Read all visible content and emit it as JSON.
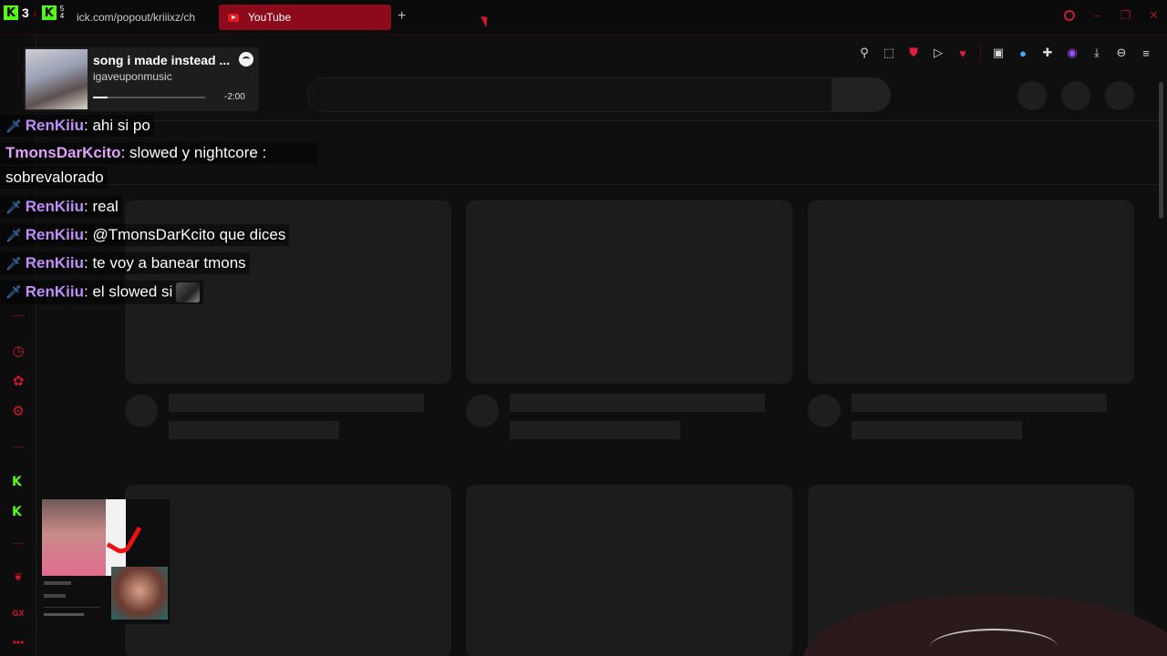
{
  "browser": {
    "top_left_indicator": "3",
    "top_left_small_top": "5",
    "top_left_small_bottom": "4",
    "url_fragment": "ick.com/popout/kriiixz/ch",
    "active_tab": "YouTube",
    "new_tab": "+"
  },
  "chat": {
    "messages": [
      {
        "user": "RenKiiu",
        "text": ": ahi si po"
      },
      {
        "user": "TmonsDarKcito",
        "text": ": slowed y nightcore :",
        "text2": "sobrevalorado"
      },
      {
        "user": "RenKiiu",
        "text": ": real"
      },
      {
        "user": "RenKiiu",
        "text": ": @TmonsDarKcito que dices"
      },
      {
        "user": "RenKiiu",
        "text": ": te voy a banear tmons"
      },
      {
        "user": "RenKiiu",
        "text": ": el slowed si"
      }
    ]
  },
  "spotify": {
    "title": "song i made instead ...",
    "artist": "igaveuponmusic",
    "time_remaining": "-2:00",
    "progress": 0.13
  },
  "colors": {
    "accent": "#d2162b",
    "tab_active": "#8d0a1d",
    "kick_green": "#53fc18",
    "username_purple": "#c58cff"
  },
  "icons": {
    "toolbar": [
      "pin-icon",
      "screenshot-icon",
      "pocket-icon",
      "send-icon",
      "heart-icon",
      "extension-icon",
      "translate-icon",
      "puzzle-icon",
      "avatar-icon",
      "download-icon",
      "link-icon",
      "menu-icon"
    ],
    "sidebar": [
      "history-icon",
      "extensions-icon",
      "settings-icon",
      "kick-icon",
      "kick-icon",
      "leaf-icon",
      "gx-icon",
      "more-icon"
    ]
  }
}
